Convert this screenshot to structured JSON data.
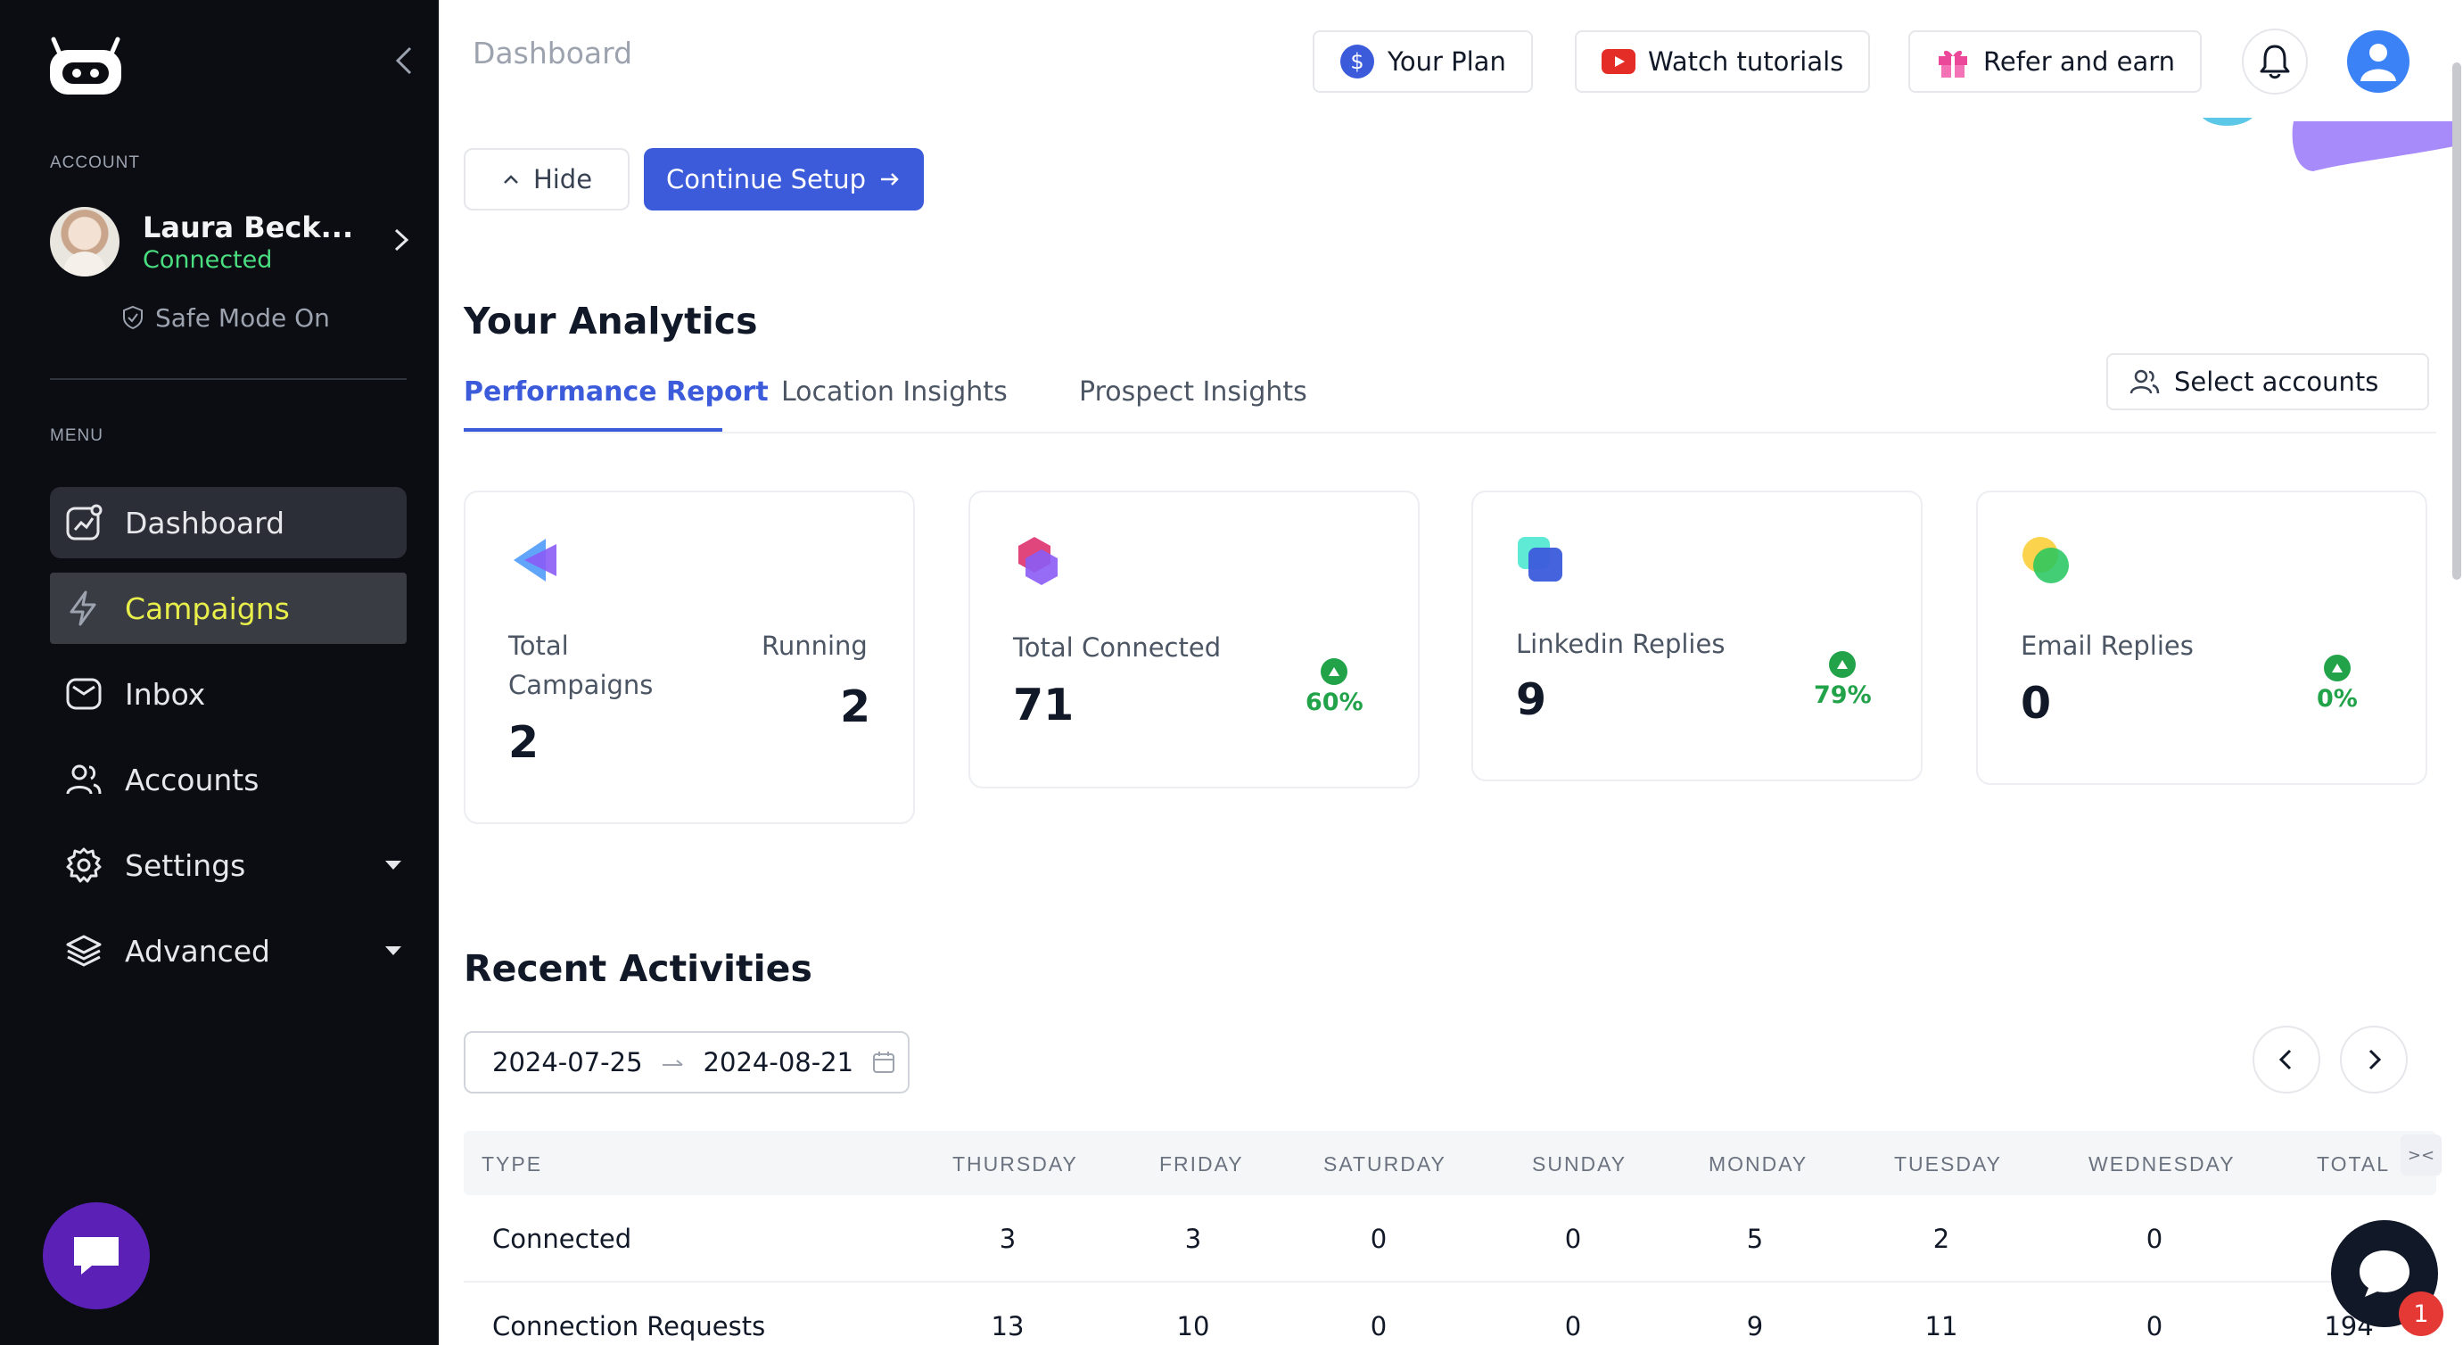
{
  "sidebar": {
    "account_label": "ACCOUNT",
    "account": {
      "name": "Laura Beck...",
      "status": "Connected",
      "safe_mode": "Safe Mode On"
    },
    "menu_label": "MENU",
    "items": [
      {
        "label": "Dashboard",
        "icon": "dashboard-icon"
      },
      {
        "label": "Campaigns",
        "icon": "lightning-icon"
      },
      {
        "label": "Inbox",
        "icon": "inbox-icon"
      },
      {
        "label": "Accounts",
        "icon": "users-icon"
      },
      {
        "label": "Settings",
        "icon": "gear-icon"
      },
      {
        "label": "Advanced",
        "icon": "layers-icon"
      }
    ]
  },
  "header": {
    "page_title": "Dashboard",
    "your_plan": "Your Plan",
    "watch_tutorials": "Watch tutorials",
    "refer": "Refer and earn"
  },
  "setup": {
    "hide": "Hide",
    "continue": "Continue Setup"
  },
  "analytics": {
    "title": "Your Analytics",
    "tabs": [
      "Performance Report",
      "Location Insights",
      "Prospect Insights"
    ],
    "select_accounts": "Select accounts",
    "cards": [
      {
        "label1": "Total",
        "label2": "Campaigns",
        "value": "2",
        "running_label": "Running",
        "running_value": "2"
      },
      {
        "label": "Total Connected",
        "value": "71",
        "pct": "60%"
      },
      {
        "label": "Linkedin Replies",
        "value": "9",
        "pct": "79%"
      },
      {
        "label": "Email Replies",
        "value": "0",
        "pct": "0%"
      }
    ]
  },
  "activities": {
    "title": "Recent Activities",
    "date_start": "2024-07-25",
    "date_end": "2024-08-21",
    "headers": [
      "TYPE",
      "THURSDAY",
      "FRIDAY",
      "SATURDAY",
      "SUNDAY",
      "MONDAY",
      "TUESDAY",
      "WEDNESDAY",
      "TOTAL"
    ],
    "rows": [
      {
        "type": "Connected",
        "values": [
          "3",
          "3",
          "0",
          "0",
          "5",
          "2",
          "0",
          ""
        ]
      },
      {
        "type": "Connection Requests",
        "values": [
          "13",
          "10",
          "0",
          "0",
          "9",
          "11",
          "0",
          "194"
        ]
      }
    ]
  },
  "chat": {
    "badge": "1"
  },
  "colors": {
    "accent": "#3b5bdb",
    "sidebar_bg": "#0b0d13",
    "success": "#22a34a",
    "campaign_highlight": "#e8ee4a"
  }
}
